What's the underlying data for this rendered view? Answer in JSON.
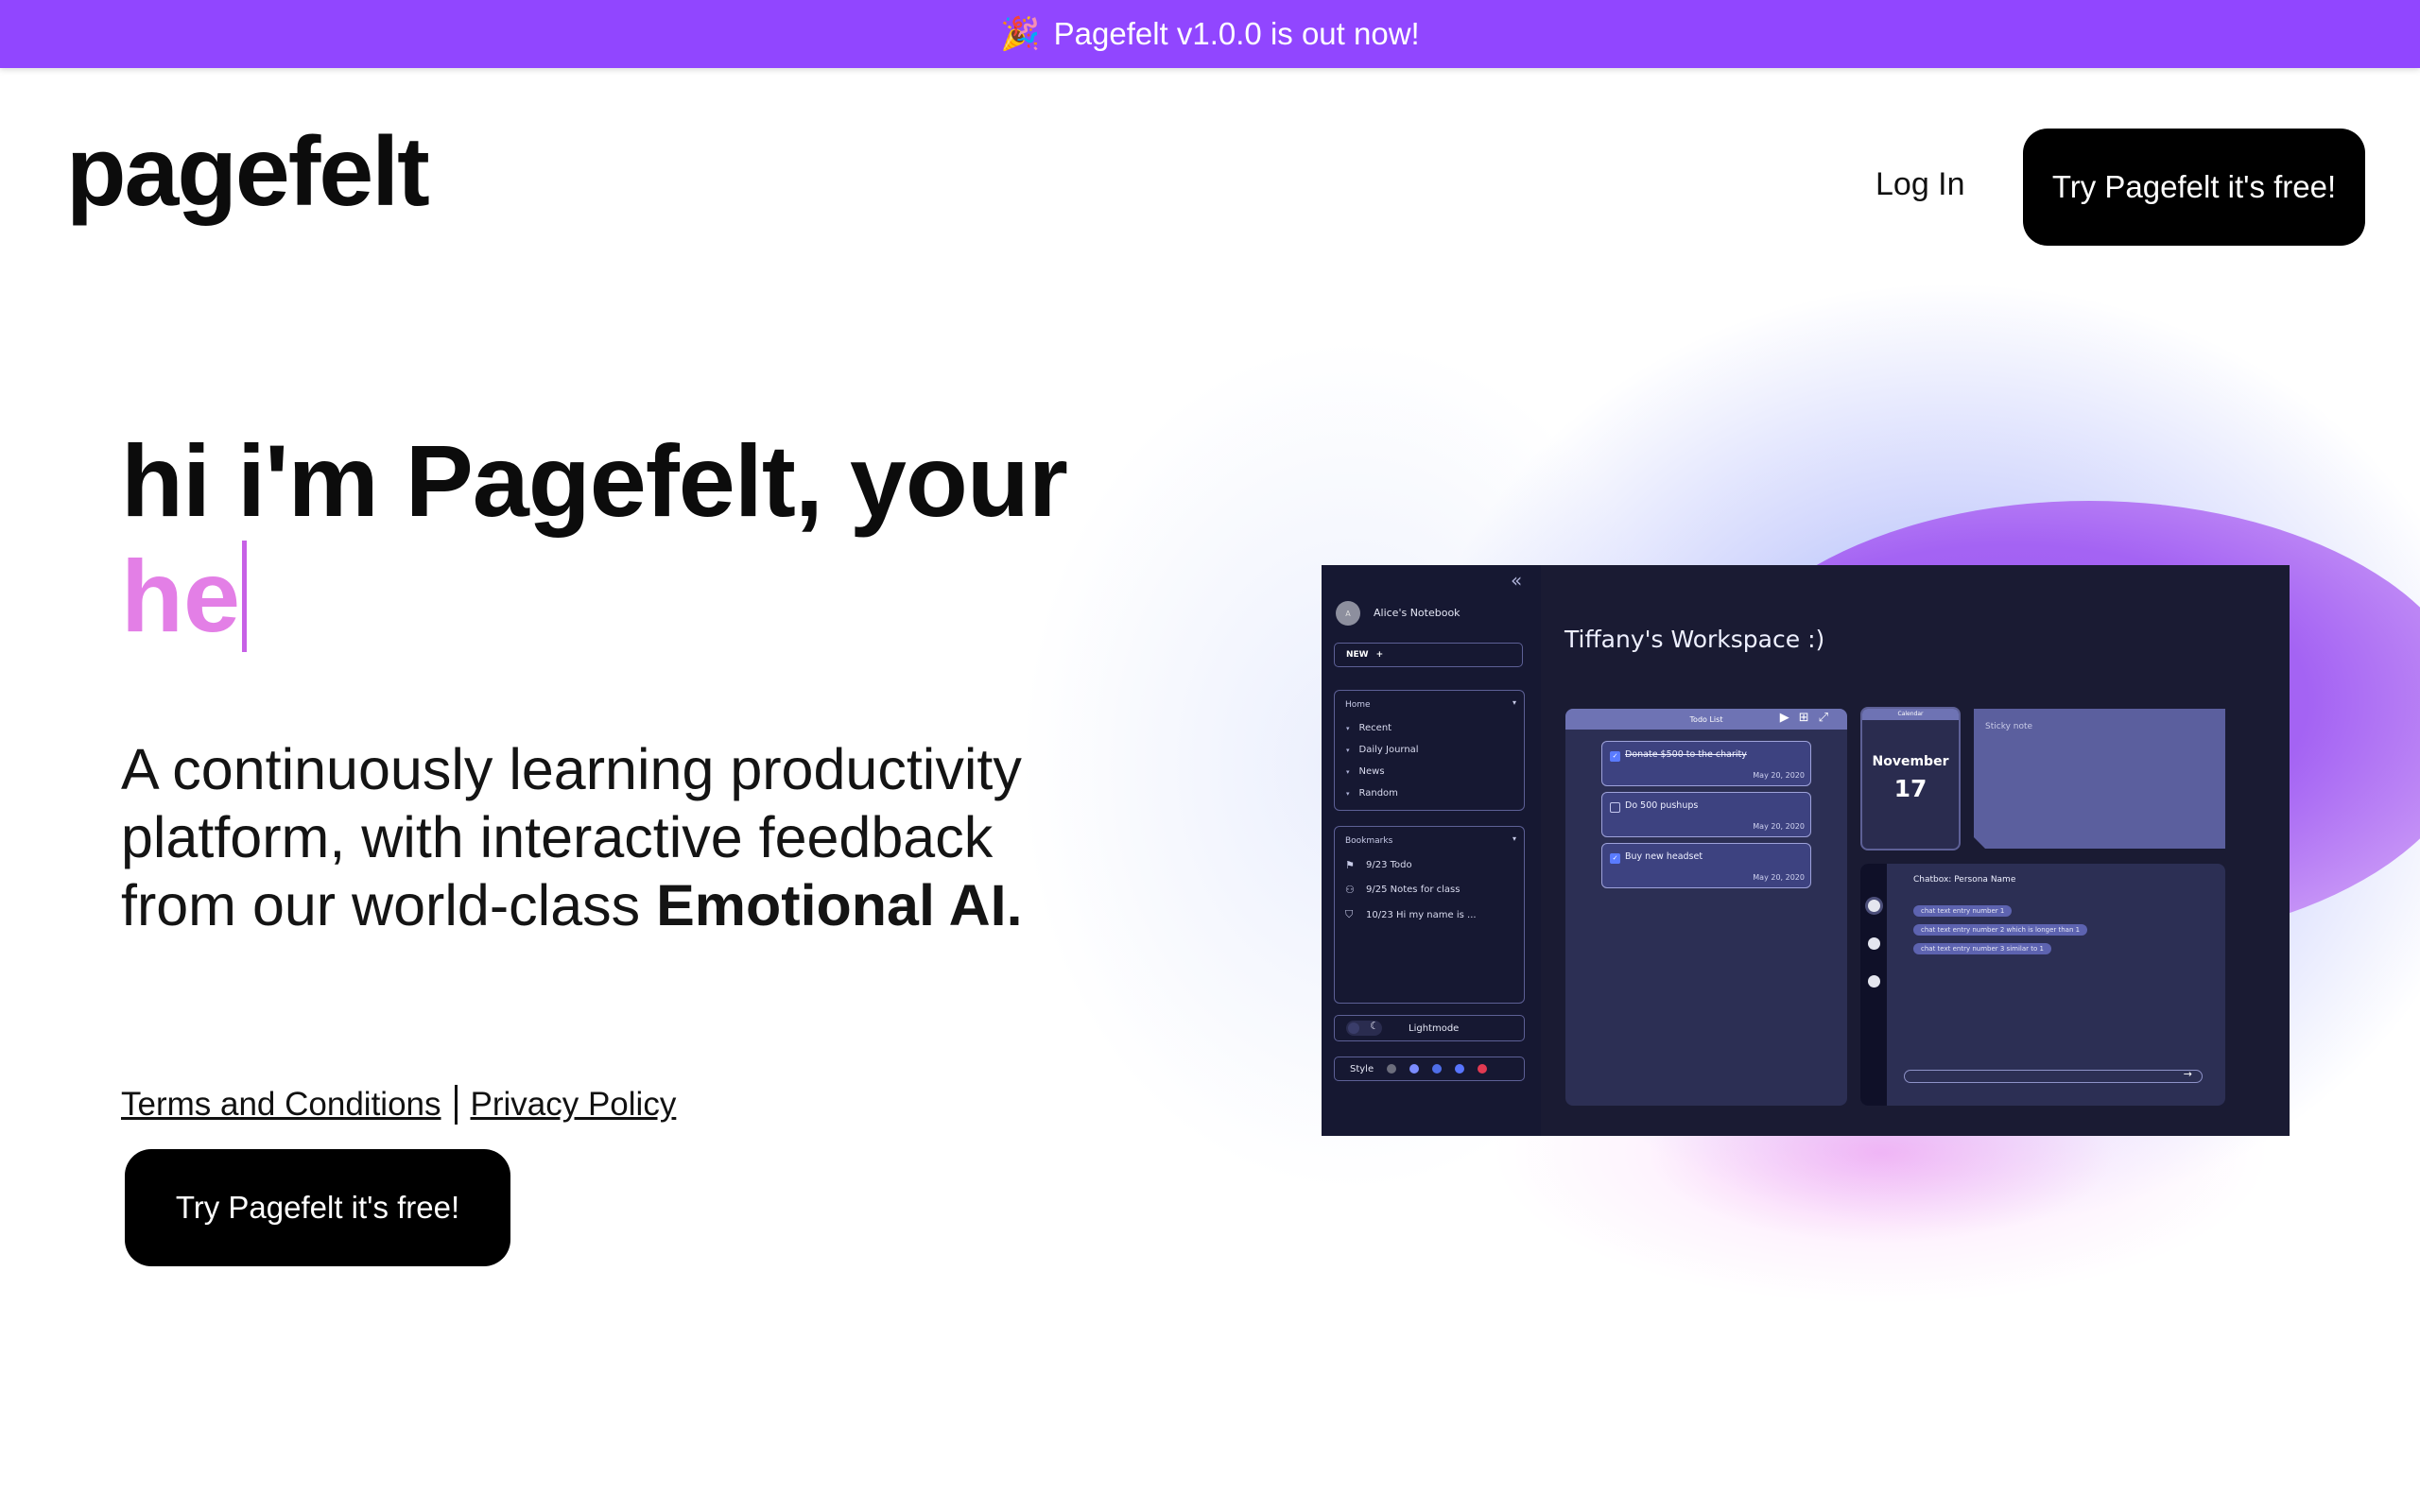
{
  "banner": {
    "icon": "party-popper-icon",
    "glyph": "🎉",
    "text": "Pagefelt v1.0.0 is out now!"
  },
  "header": {
    "logo": "pagefelt",
    "login_label": "Log In",
    "cta_label": "Try Pagefelt it's free!"
  },
  "hero": {
    "line1": "hi i'm Pagefelt, your",
    "typed": "he",
    "subtitle_plain": "A continuously learning productivity platform, with interactive feedback from our world-class",
    "subtitle_bold": "Emotional AI.",
    "terms_label": "Terms and Conditions",
    "privacy_label": "Privacy Policy",
    "cta_label": "Try Pagefelt it's free!"
  },
  "preview": {
    "notebook_avatar": "A",
    "notebook_name": "Alice's Notebook",
    "new_label": "NEW",
    "new_icon": "+",
    "home": {
      "title": "Home",
      "items": [
        "Recent",
        "Daily Journal",
        "News",
        "Random"
      ]
    },
    "bookmarks": {
      "title": "Bookmarks",
      "items": [
        {
          "icon": "⚑",
          "label": "9/23 Todo"
        },
        {
          "icon": "⚇",
          "label": "9/25 Notes for class"
        },
        {
          "icon": "⛉",
          "label": "10/23 Hi my name is ..."
        }
      ]
    },
    "mode_label": "Lightmode",
    "style_label": "Style",
    "style_colors": [
      "#6b6d7c",
      "#7b8cff",
      "#4f6ee8",
      "#5875ff",
      "#e23a52"
    ],
    "workspace_title": "Tiffany's Workspace :)",
    "todo": {
      "title": "Todo List",
      "tasks": [
        {
          "text": "Donate $500 to the charity",
          "date": "May 20, 2020",
          "done": true
        },
        {
          "text": "Do 500 pushups",
          "date": "May 20, 2020",
          "done": false
        },
        {
          "text": "Buy new headset",
          "date": "May 20, 2020",
          "done": true
        }
      ]
    },
    "calendar": {
      "title": "Calendar",
      "month": "November",
      "day": "17"
    },
    "sticky": {
      "label": "Sticky note"
    },
    "chat": {
      "title": "Chatbox: Persona Name",
      "entries": [
        "chat text entry number 1",
        "chat text entry number 2 which is longer than 1",
        "chat text entry number 3 similar to 1"
      ]
    }
  }
}
